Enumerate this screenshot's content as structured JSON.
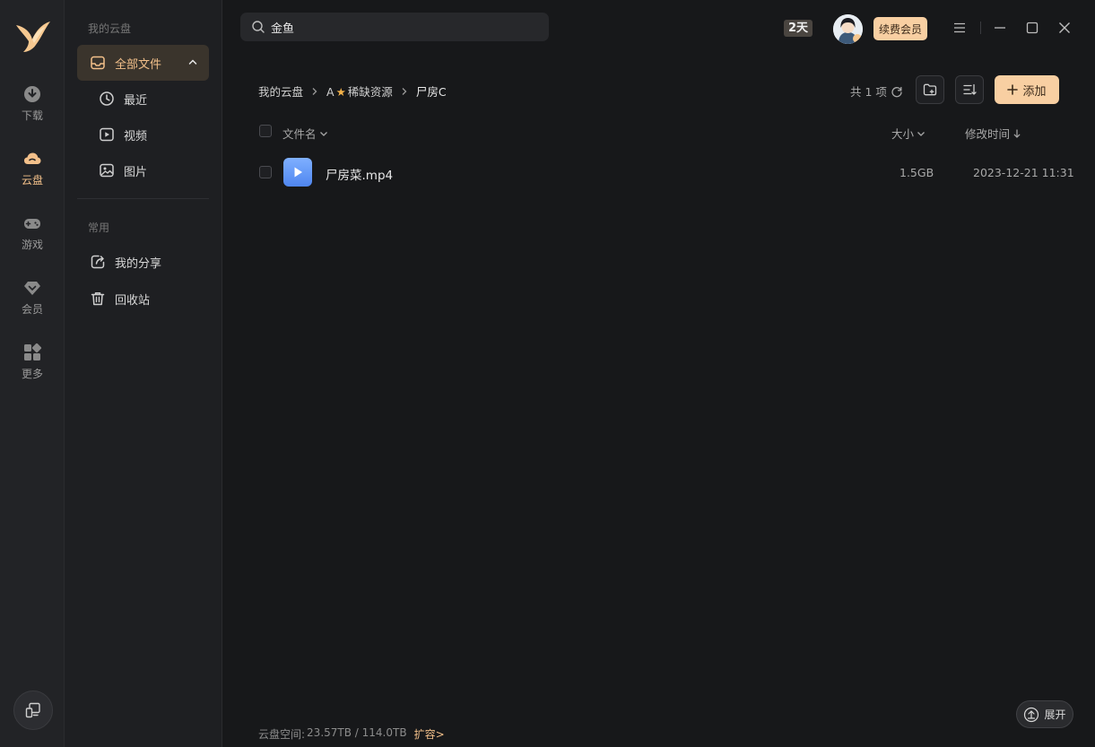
{
  "rail": {
    "items": [
      {
        "label": "下载",
        "icon": "download-icon"
      },
      {
        "label": "云盘",
        "icon": "cloud-icon"
      },
      {
        "label": "游戏",
        "icon": "gamepad-icon"
      },
      {
        "label": "会员",
        "icon": "diamond-icon"
      },
      {
        "label": "更多",
        "icon": "apps-grid-icon"
      }
    ],
    "active_color": "#f3c08a"
  },
  "sidebar": {
    "section1_title": "我的云盘",
    "all_files": "全部文件",
    "sub_items": [
      {
        "label": "最近",
        "icon": "clock-icon"
      },
      {
        "label": "视频",
        "icon": "video-icon"
      },
      {
        "label": "图片",
        "icon": "image-icon"
      }
    ],
    "section2_title": "常用",
    "common_items": [
      {
        "label": "我的分享",
        "icon": "share-icon"
      },
      {
        "label": "回收站",
        "icon": "trash-icon"
      }
    ]
  },
  "topbar": {
    "search_value": "金鱼",
    "days_badge": "2天",
    "renew_label": "续费会员"
  },
  "breadcrumb": {
    "root": "我的云盘",
    "level1_prefix": "A",
    "level1_star": "★",
    "level1_name": "稀缺资源",
    "current": "尸房C"
  },
  "toolbar": {
    "count": "共 1 项",
    "add_label": "添加"
  },
  "table": {
    "headers": {
      "name": "文件名",
      "size": "大小",
      "modified": "修改时间"
    },
    "rows": [
      {
        "name": "尸房菜.mp4",
        "size": "1.5GB",
        "modified": "2023-12-21 11:31"
      }
    ]
  },
  "footer": {
    "storage_label": "云盘空间:",
    "storage_value": "23.57TB / 114.0TB",
    "expand_storage": "扩容>",
    "expand_button": "展开"
  },
  "colors": {
    "background": "#17181a",
    "accent": "#f8cfa2",
    "accent_text": "#f3c08a"
  }
}
